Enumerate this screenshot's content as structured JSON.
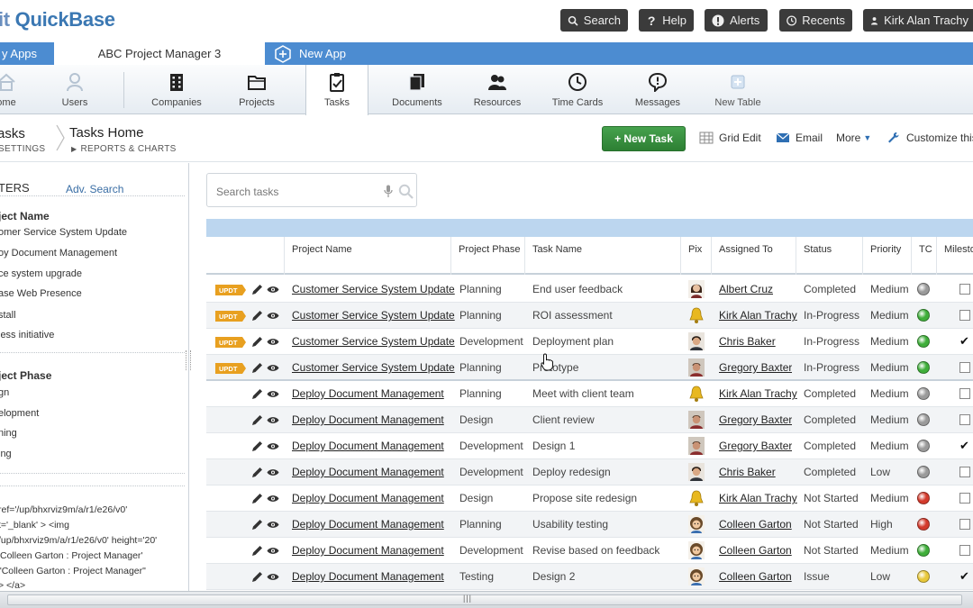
{
  "app": {
    "logo_prefix": "it",
    "logo_name": "QuickBase"
  },
  "topnav": {
    "search": "Search",
    "help": "Help",
    "alerts": "Alerts",
    "recents": "Recents",
    "user": "Kirk Alan Trachy"
  },
  "apptabs": {
    "my_apps": "y Apps",
    "current": "ABC Project Manager 3",
    "new_app": "New App"
  },
  "tables": [
    {
      "label": "ome",
      "icon": "house-icon"
    },
    {
      "label": "Users",
      "icon": "user-icon"
    },
    {
      "label": "Companies",
      "icon": "building-icon"
    },
    {
      "label": "Projects",
      "icon": "folder-icon"
    },
    {
      "label": "Tasks",
      "icon": "clipboard-icon"
    },
    {
      "label": "Documents",
      "icon": "documents-icon"
    },
    {
      "label": "Resources",
      "icon": "people-icon"
    },
    {
      "label": "Time Cards",
      "icon": "clock-icon"
    },
    {
      "label": "Messages",
      "icon": "speech-bubble-icon"
    },
    {
      "label": "New Table",
      "icon": "plus-icon"
    }
  ],
  "breadcrumb": {
    "parent": "asks",
    "parent_sub": "SETTINGS",
    "current": "Tasks Home",
    "current_sub": "REPORTS & CHARTS"
  },
  "actions": {
    "new_task": "+ New Task",
    "grid_edit": "Grid Edit",
    "email": "Email",
    "more": "More",
    "customize": "Customize this"
  },
  "filters": {
    "title": "TERS",
    "adv_search": "Adv. Search",
    "project_name_head": "ject Name",
    "project_names": [
      "omer Service System Update",
      "oy Document Management",
      "ce system upgrade",
      "ase Web Presence",
      "stall",
      "less initiative"
    ],
    "project_phase_head": "ject Phase",
    "project_phases": [
      "gn",
      "elopment",
      "ning",
      "ing"
    ],
    "code_lines": [
      "ref='/up/bhxrviz9m/a/r1/e26/v0'",
      "t='_blank' > <img",
      "/up/bhxrviz9m/a/r1/e26/v0' height='20'",
      "'Colleen Garton : Project Manager'",
      "\"Colleen Garton : Project Manager\"",
      "> </a>"
    ]
  },
  "search": {
    "placeholder": "Search tasks"
  },
  "grid": {
    "columns": {
      "project_name": "Project Name",
      "project_phase": "Project Phase",
      "task_name": "Task Name",
      "pix": "Pix",
      "assigned_to": "Assigned To",
      "status": "Status",
      "priority": "Priority",
      "tc": "TC",
      "milestone": "Milesto"
    },
    "updt_label": "UPDT",
    "rows": [
      {
        "updt": true,
        "project": "Customer Service System Update",
        "phase": "Planning",
        "task": "End user feedback",
        "avatar": "woman",
        "assigned": "Albert Cruz",
        "status": "Completed",
        "priority": "Medium",
        "tc": "gray",
        "milestone": false
      },
      {
        "updt": true,
        "project": "Customer Service System Update",
        "phase": "Planning",
        "task": "ROI assessment",
        "avatar": "bell",
        "assigned": "Kirk Alan Trachy",
        "status": "In-Progress",
        "priority": "Medium",
        "tc": "green",
        "milestone": false
      },
      {
        "updt": true,
        "project": "Customer Service System Update",
        "phase": "Development",
        "task": "Deployment plan",
        "avatar": "man",
        "assigned": "Chris Baker",
        "status": "In-Progress",
        "priority": "Medium",
        "tc": "green",
        "milestone": true
      },
      {
        "updt": true,
        "project": "Customer Service System Update",
        "phase": "Planning",
        "task": "Prototype",
        "avatar": "man2",
        "assigned": "Gregory Baxter",
        "status": "In-Progress",
        "priority": "Medium",
        "tc": "green",
        "milestone": false
      },
      {
        "updt": false,
        "project": "Deploy Document Management",
        "phase": "Planning",
        "task": "Meet with client team",
        "avatar": "bell",
        "assigned": "Kirk Alan Trachy",
        "status": "Completed",
        "priority": "Medium",
        "tc": "gray",
        "milestone": false
      },
      {
        "updt": false,
        "project": "Deploy Document Management",
        "phase": "Design",
        "task": "Client review",
        "avatar": "man2",
        "assigned": "Gregory Baxter",
        "status": "Completed",
        "priority": "Medium",
        "tc": "gray",
        "milestone": false
      },
      {
        "updt": false,
        "project": "Deploy Document Management",
        "phase": "Development",
        "task": "Design 1",
        "avatar": "man2",
        "assigned": "Gregory Baxter",
        "status": "Completed",
        "priority": "Medium",
        "tc": "gray",
        "milestone": true
      },
      {
        "updt": false,
        "project": "Deploy Document Management",
        "phase": "Development",
        "task": "Deploy redesign",
        "avatar": "man",
        "assigned": "Chris Baker",
        "status": "Completed",
        "priority": "Low",
        "tc": "gray",
        "milestone": false
      },
      {
        "updt": false,
        "project": "Deploy Document Management",
        "phase": "Design",
        "task": "Propose site redesign",
        "avatar": "bell",
        "assigned": "Kirk Alan Trachy",
        "status": "Not Started",
        "priority": "Medium",
        "tc": "red",
        "milestone": false
      },
      {
        "updt": false,
        "project": "Deploy Document Management",
        "phase": "Planning",
        "task": "Usability testing",
        "avatar": "girl",
        "assigned": "Colleen Garton",
        "status": "Not Started",
        "priority": "High",
        "tc": "red",
        "milestone": false
      },
      {
        "updt": false,
        "project": "Deploy Document Management",
        "phase": "Development",
        "task": "Revise based on feedback",
        "avatar": "girl",
        "assigned": "Colleen Garton",
        "status": "Not Started",
        "priority": "Medium",
        "tc": "green",
        "milestone": false
      },
      {
        "updt": false,
        "project": "Deploy Document Management",
        "phase": "Testing",
        "task": "Design 2",
        "avatar": "girl",
        "assigned": "Colleen Garton",
        "status": "Issue",
        "priority": "Low",
        "tc": "yellow",
        "milestone": true
      }
    ]
  },
  "colors": {
    "brand_blue": "#4c8cd1",
    "logo_blue": "#3b78b3",
    "topbar_button": "#3b3b3b",
    "new_task_green": "#2d7f33",
    "tc_gray": "#9a9a9a",
    "tc_green": "#3fae3a",
    "tc_red": "#d33a2c",
    "tc_yellow": "#e8c83a",
    "updt_orange": "#e8a020"
  }
}
